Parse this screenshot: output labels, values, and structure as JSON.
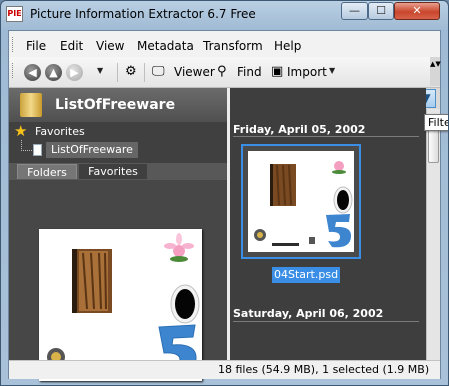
{
  "window": {
    "title": "Picture Information Extractor 6.7 Free",
    "app_icon_text": "PIE",
    "minimize_glyph": "—",
    "maximize_glyph": "☐",
    "close_glyph": "✕"
  },
  "menu": [
    "File",
    "Edit",
    "View",
    "Metadata",
    "Transform",
    "Help"
  ],
  "toolbar": {
    "back_glyph": "◀",
    "up_glyph": "▲",
    "forward_glyph": "▶",
    "dropdown_glyph": "▼",
    "viewer_label": "Viewer",
    "find_label": "Find",
    "import_label": "Import",
    "overflow_glyph": "▲▼"
  },
  "folder_panel": {
    "current_folder": "ListOfFreeware",
    "favorites_label": "Favorites",
    "favorite_item": "ListOfFreeware",
    "tabs": [
      "Folders",
      "Favorites"
    ]
  },
  "thumbnail_panel": {
    "groups": [
      {
        "date": "Friday, April 05, 2002",
        "items": [
          {
            "name": "04Start.psd",
            "selected": true
          }
        ]
      },
      {
        "date": "Saturday, April 06, 2002",
        "items": []
      }
    ],
    "filter_glyph": "▼",
    "tooltip": "Filter"
  },
  "status": {
    "text": "18 files (54.9 MB), 1 selected (1.9 MB)"
  },
  "colors": {
    "selection": "#3a8ee6",
    "panel_dark": "#3e3e3e",
    "accent_star": "#f6c21a"
  }
}
